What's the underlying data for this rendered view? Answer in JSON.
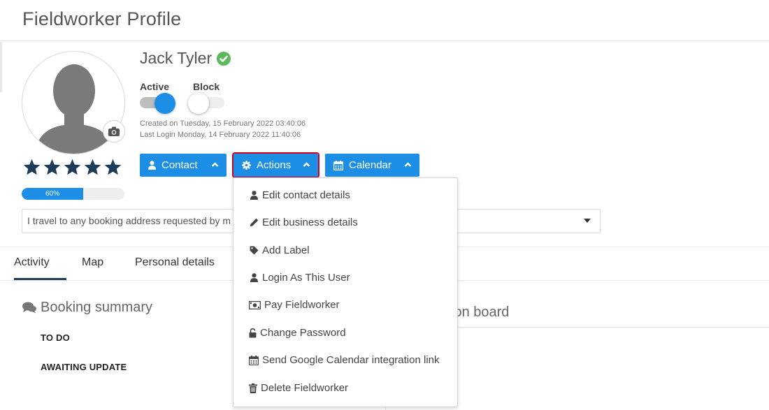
{
  "header": {
    "title": "Fieldworker Profile"
  },
  "profile": {
    "name": "Jack Tyler",
    "rating_stars": 5,
    "completion_label": "60%",
    "completion_fraction": 0.6,
    "toggles": {
      "active_label": "Active",
      "active_on": true,
      "block_label": "Block",
      "block_on": false
    },
    "created": "Created on Tuesday, 15 February 2022 03:40:06",
    "last_login": "Last Login Monday, 14 February 2022 11:40:06",
    "bio": "I travel to any booking address requested by m"
  },
  "buttons": {
    "contact": "Contact",
    "actions": "Actions",
    "calendar": "Calendar"
  },
  "actions_menu": {
    "items": [
      {
        "label": "Edit contact details",
        "icon": "user-icon"
      },
      {
        "label": "Edit business details",
        "icon": "pencil-icon"
      },
      {
        "label": "Add Label",
        "icon": "tag-icon"
      },
      {
        "label": "Login As This User",
        "icon": "user-icon"
      },
      {
        "label": "Pay Fieldworker",
        "icon": "money-icon"
      },
      {
        "label": "Change Password",
        "icon": "unlock-icon"
      },
      {
        "label": "Send Google Calendar integration link",
        "icon": "calendar-icon"
      },
      {
        "label": "Delete Fieldworker",
        "icon": "trash-icon"
      }
    ]
  },
  "tabs": [
    {
      "label": "Activity",
      "active": true
    },
    {
      "label": "Map",
      "active": false
    },
    {
      "label": "Personal details",
      "active": false
    }
  ],
  "booking_summary": {
    "title": "Booking summary",
    "items": [
      "TO DO",
      "AWAITING UPDATE"
    ]
  },
  "discussion": {
    "title_visible": "sion board"
  },
  "colors": {
    "primary": "#1c8ee6",
    "highlight": "#d0021b",
    "verified": "#5cb85c",
    "star": "#1d3c5a"
  }
}
